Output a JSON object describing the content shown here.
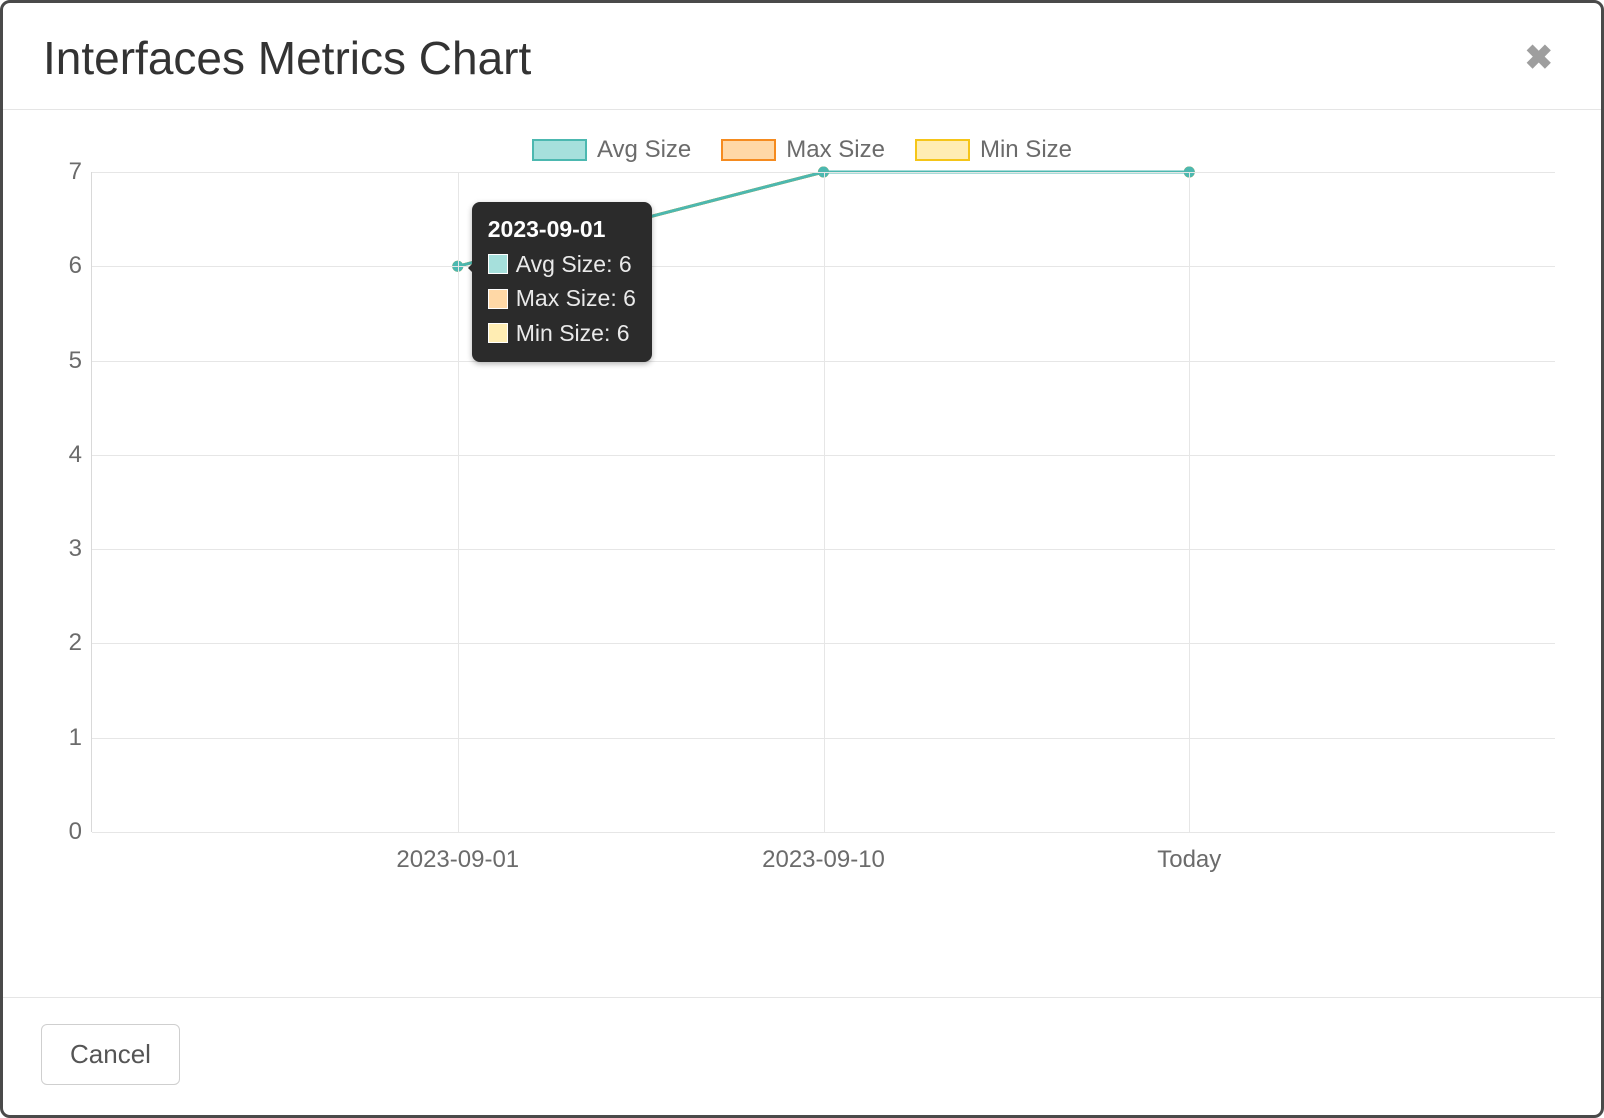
{
  "modal": {
    "title": "Interfaces Metrics Chart",
    "cancel_label": "Cancel"
  },
  "colors": {
    "avg": {
      "fill": "#a6e0dc",
      "stroke": "#4cb8b0"
    },
    "max": {
      "fill": "#ffd8a6",
      "stroke": "#f58b1f"
    },
    "min": {
      "fill": "#ffedb3",
      "stroke": "#f5c518"
    }
  },
  "legend": {
    "avg": "Avg Size",
    "max": "Max Size",
    "min": "Min Size"
  },
  "tooltip": {
    "title": "2023-09-01",
    "rows": [
      {
        "key": "avg",
        "text": "Avg Size: 6"
      },
      {
        "key": "max",
        "text": "Max Size: 6"
      },
      {
        "key": "min",
        "text": "Min Size: 6"
      }
    ]
  },
  "chart_data": {
    "type": "line",
    "categories": [
      "2023-09-01",
      "2023-09-10",
      "Today"
    ],
    "series": [
      {
        "name": "Avg Size",
        "key": "avg",
        "values": [
          6,
          7,
          7
        ]
      },
      {
        "name": "Max Size",
        "key": "max",
        "values": [
          6,
          7,
          7
        ]
      },
      {
        "name": "Min Size",
        "key": "min",
        "values": [
          6,
          7,
          7
        ]
      }
    ],
    "ylim": [
      0,
      7
    ],
    "y_ticks": [
      0,
      1,
      2,
      3,
      4,
      5,
      6,
      7
    ],
    "xlabel": "",
    "ylabel": "",
    "title": ""
  }
}
